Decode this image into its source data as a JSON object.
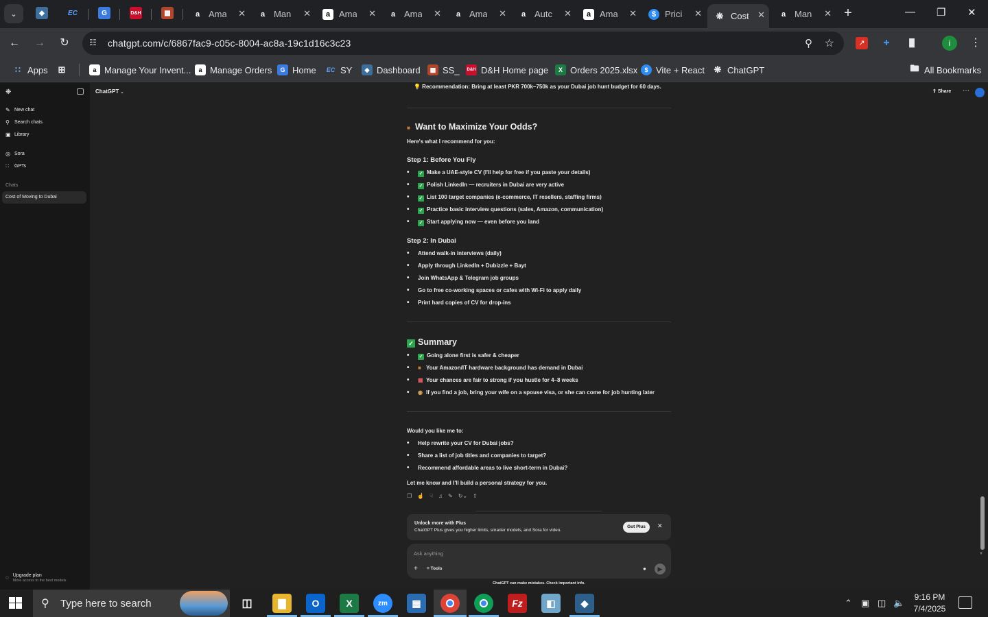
{
  "browser": {
    "url": "chatgpt.com/c/6867fac9-c05c-8004-ac8a-19c1d16c3c23",
    "tabs": [
      {
        "label": "Ama"
      },
      {
        "label": "Man"
      },
      {
        "label": "Ama"
      },
      {
        "label": "Ama"
      },
      {
        "label": "Ama"
      },
      {
        "label": "Autc"
      },
      {
        "label": "Ama"
      },
      {
        "label": "Pricii"
      },
      {
        "label": "Cost"
      },
      {
        "label": "Man"
      }
    ],
    "bookmarks": {
      "apps": "Apps",
      "manage_inventory": "Manage Your Invent...",
      "manage_orders": "Manage Orders",
      "home": "Home",
      "sy": "SY",
      "dashboard": "Dashboard",
      "ss": "SS_",
      "dh_home": "D&H Home page",
      "orders": "Orders 2025.xlsx",
      "vite": "Vite + React",
      "chatgpt": "ChatGPT",
      "all": "All Bookmarks"
    }
  },
  "sidebar": {
    "new_chat": "New chat",
    "search_chats": "Search chats",
    "library": "Library",
    "sora": "Sora",
    "gpts": "GPTs",
    "section": "Chats",
    "active_chat": "Cost of Moving to Dubai",
    "upgrade_title": "Upgrade plan",
    "upgrade_sub": "More access to the best models"
  },
  "header": {
    "model": "ChatGPT",
    "share": "Share"
  },
  "message": {
    "recommendation": "💡 Recommendation: Bring at least PKR 700k–750k as your Dubai job hunt budget for 60 days.",
    "maximize_heading": "Want to Maximize Your Odds?",
    "maximize_intro": "Here's what I recommend for you:",
    "step1_heading": "Step 1: Before You Fly",
    "step1_items": [
      "Make a UAE-style CV (I'll help for free if you paste your details)",
      "Polish LinkedIn — recruiters in Dubai are very active",
      "List 100 target companies (e-commerce, IT resellers, staffing firms)",
      "Practice basic interview questions (sales, Amazon, communication)",
      "Start applying now — even before you land"
    ],
    "step2_heading": "Step 2: In Dubai",
    "step2_items": [
      "Attend walk-in interviews (daily)",
      "Apply through LinkedIn + Dubizzle + Bayt",
      "Join WhatsApp & Telegram job groups",
      "Go to free co-working spaces or cafes with Wi-Fi to apply daily",
      "Print hard copies of CV for drop-ins"
    ],
    "summary_heading": "Summary",
    "summary_items": [
      "Going alone first is safer & cheaper",
      "Your Amazon/IT hardware background has demand in Dubai",
      "Your chances are fair to strong if you hustle for 4–8 weeks",
      "If you find a job, bring your wife on a spouse visa, or she can come for job hunting later"
    ],
    "offer_intro": "Would you like me to:",
    "offer_items": [
      "Help rewrite your CV for Dubai jobs?",
      "Share a list of job titles and companies to target?",
      "Recommend affordable areas to live short-term in Dubai?"
    ],
    "closing": "Let me know and I'll build a personal strategy for you."
  },
  "plus_banner": {
    "title": "Unlock more with Plus",
    "subtitle": "ChatGPT Plus gives you higher limits, smarter models, and Sora for video.",
    "button": "Got Plus"
  },
  "composer": {
    "placeholder": "Ask anything",
    "tools": "Tools",
    "disclaimer": "ChatGPT can make mistakes. Check important info."
  },
  "taskbar": {
    "search_placeholder": "Type here to search",
    "time": "9:16 PM",
    "date": "7/4/2025"
  }
}
